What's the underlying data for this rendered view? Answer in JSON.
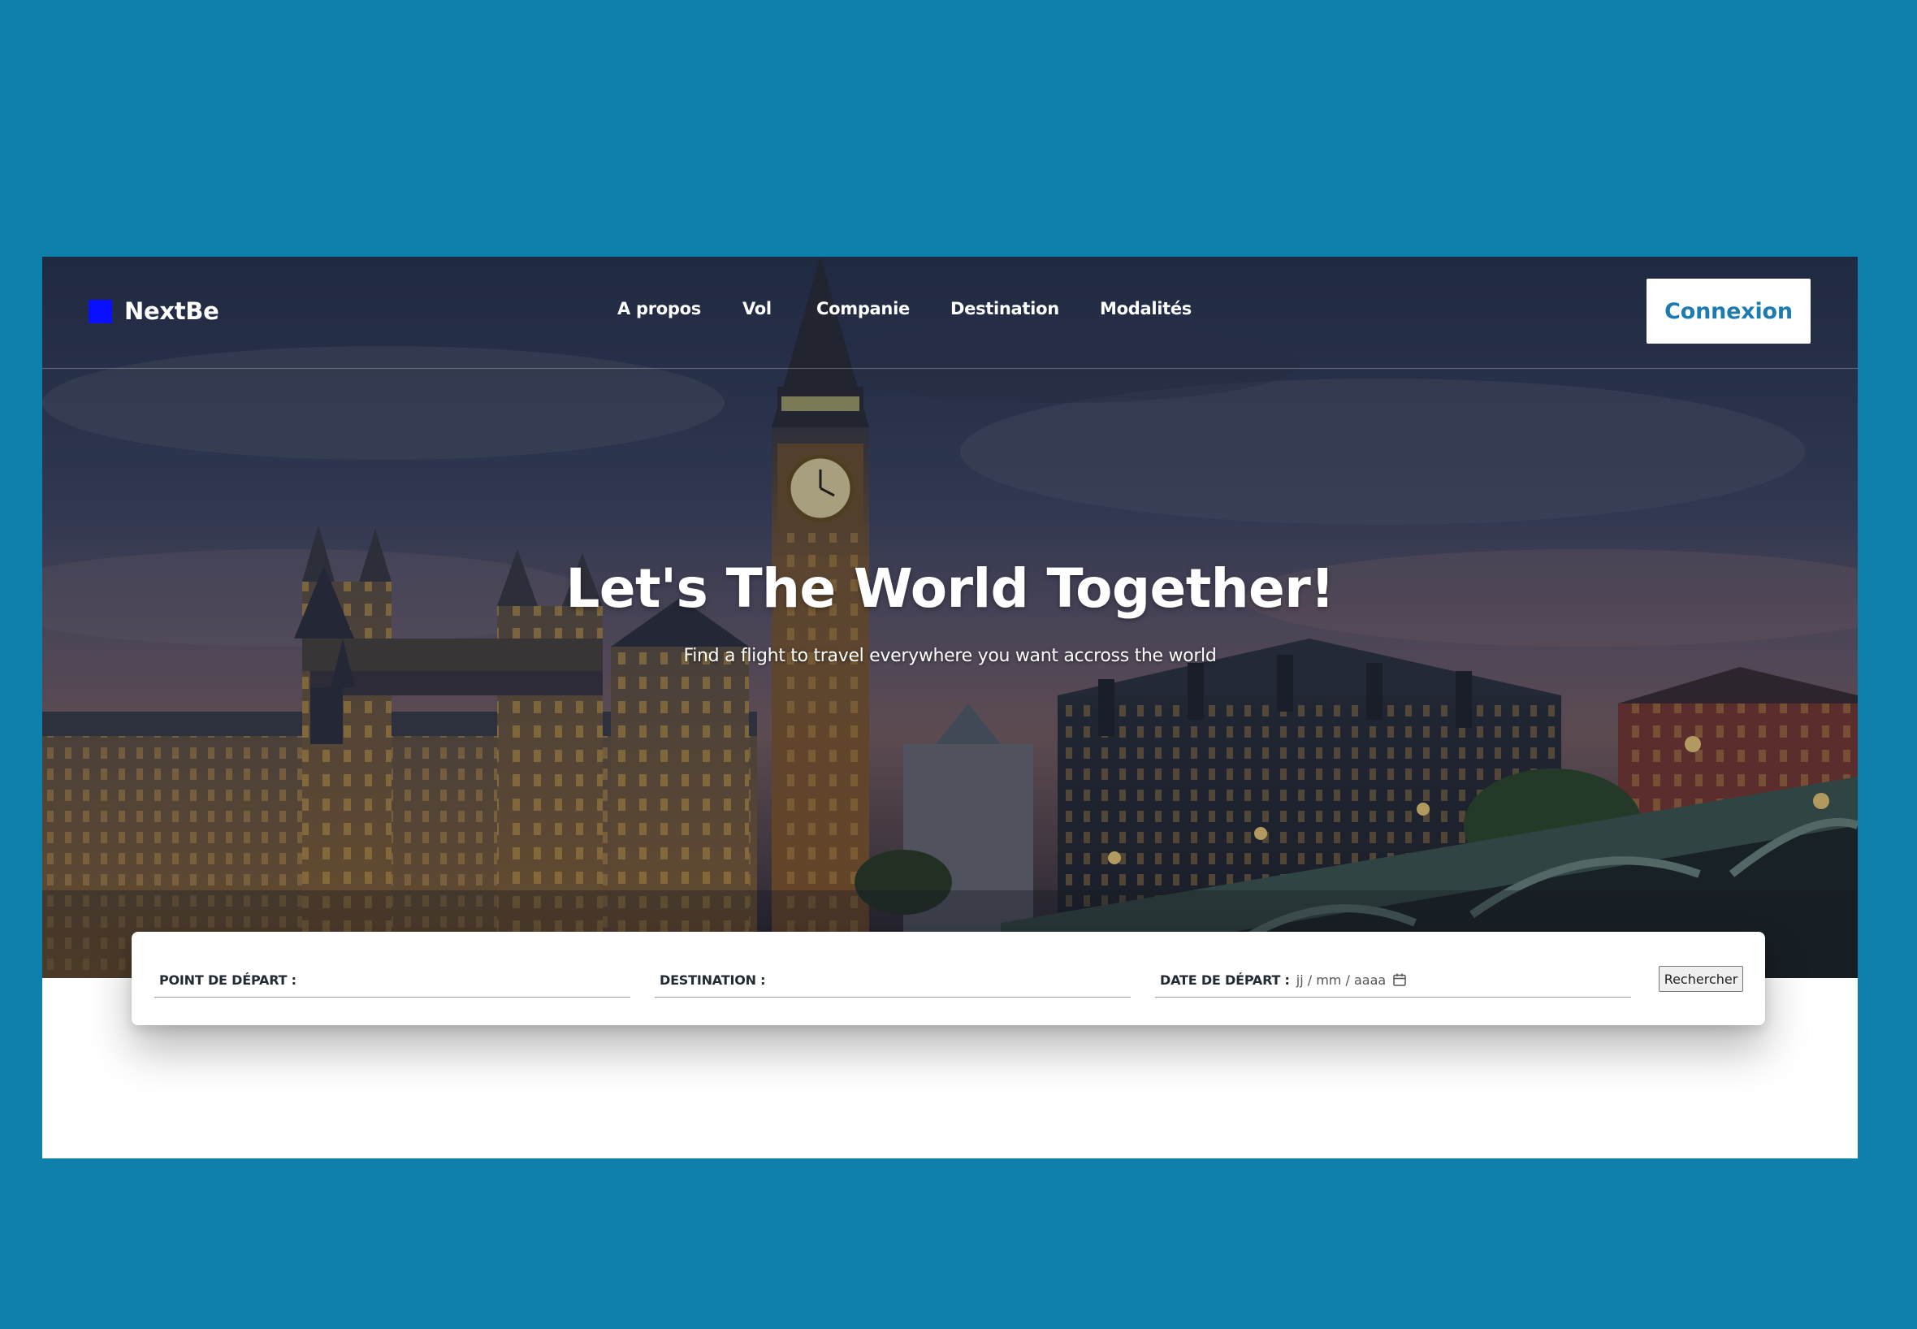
{
  "brand": {
    "name": "NextBe",
    "logo_color": "#0a10ff"
  },
  "nav": {
    "links": [
      "A propos",
      "Vol",
      "Companie",
      "Destination",
      "Modalités"
    ],
    "login_label": "Connexion"
  },
  "hero": {
    "title": "Let's The World Together!",
    "subtitle": "Find a flight to travel everywhere you want accross the world",
    "background": "london-big-ben-photo"
  },
  "search": {
    "departure_label": "POINT DE DÉPART :",
    "departure_value": "",
    "destination_label": "DESTINATION :",
    "destination_value": "",
    "date_label": "DATE DE DÉPART :",
    "date_placeholder": "jj / mm / aaaa",
    "date_icon": "calendar-icon",
    "submit_label": "Rechercher"
  },
  "colors": {
    "page_background": "#0d81ac",
    "accent": "#1e7bb0",
    "logo": "#0a10ff"
  }
}
